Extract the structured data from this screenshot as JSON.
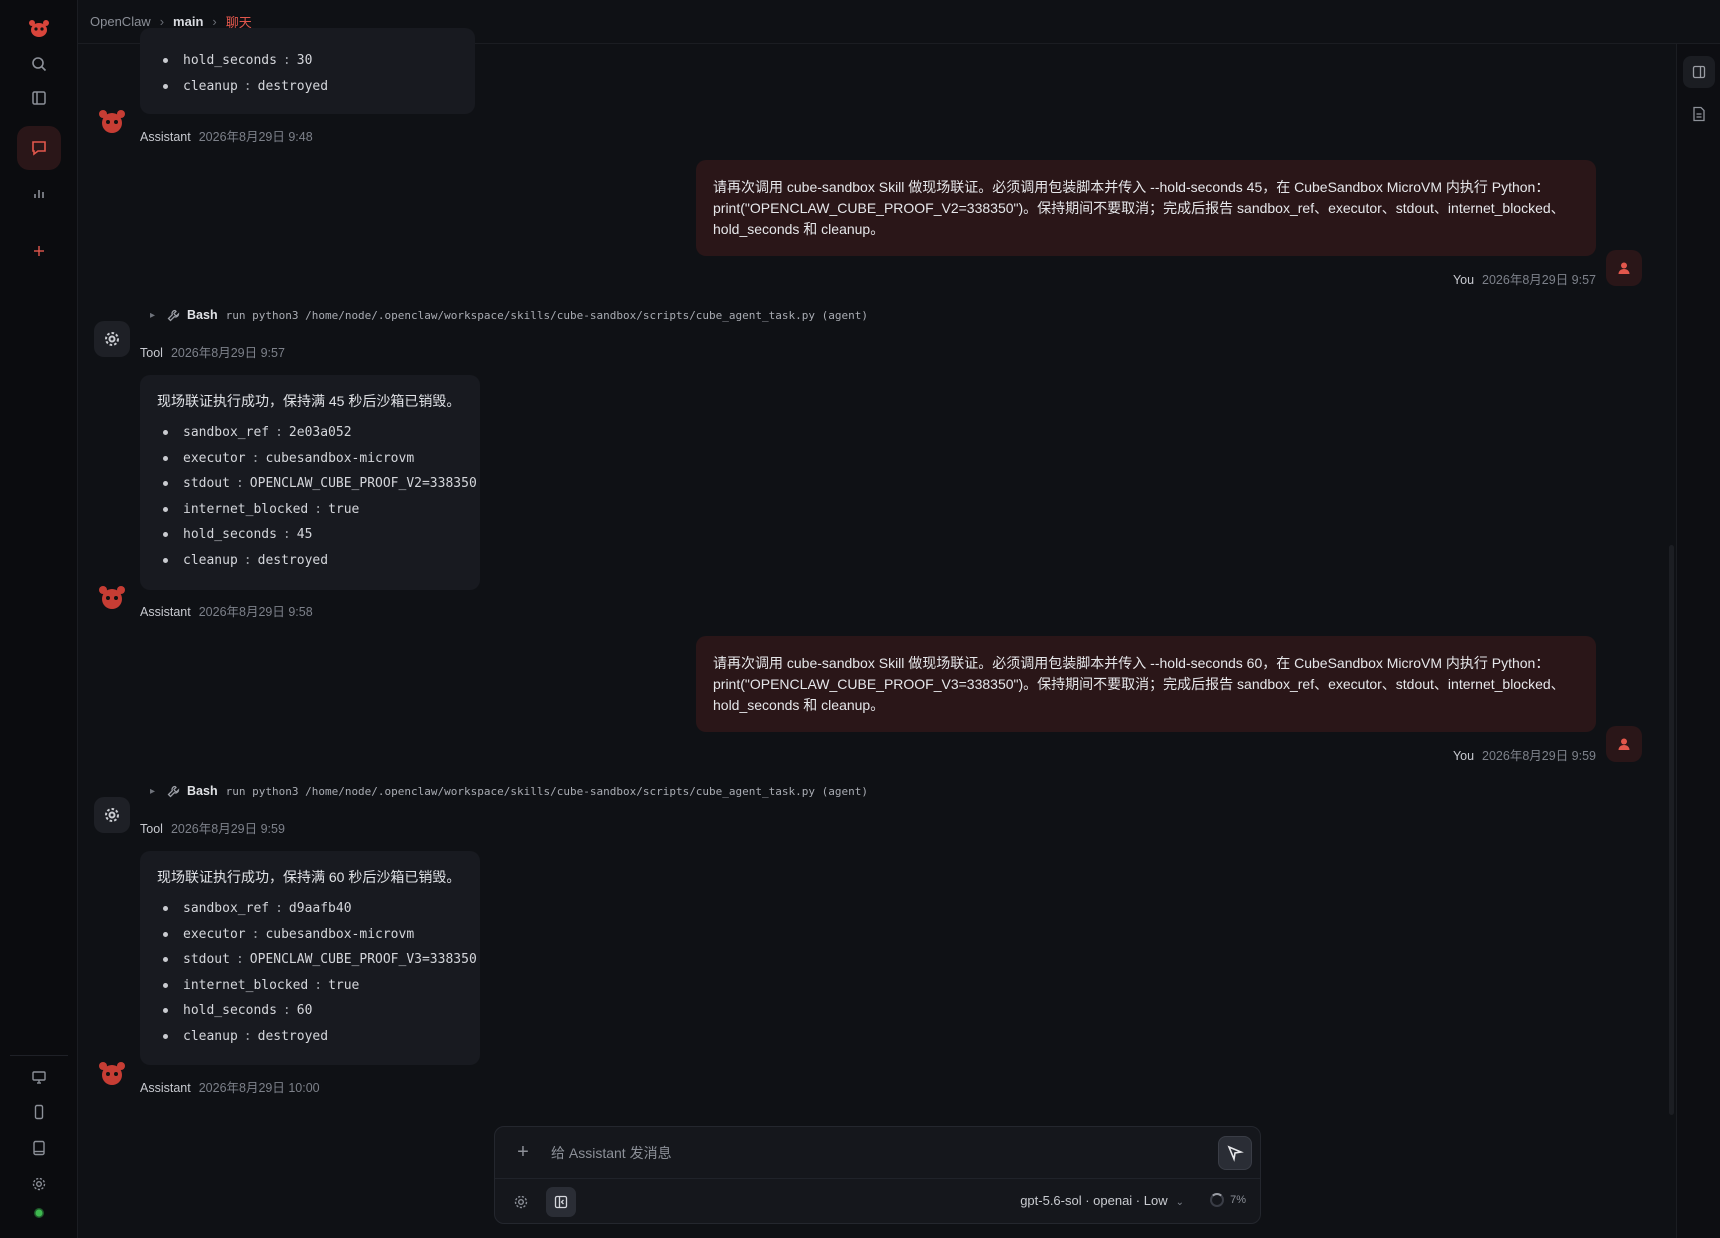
{
  "breadcrumb": {
    "root": "OpenClaw",
    "branch": "main",
    "page": "聊天"
  },
  "colors": {
    "accent": "#e2574c",
    "user_bubble": "#2a1618",
    "assistant_bubble": "#181a20",
    "status_online": "#3fb950"
  },
  "rail": {
    "icons": [
      "logo-icon",
      "search-icon",
      "layout-icon",
      "chat-icon",
      "chart-icon",
      "plus-icon",
      "monitor-icon",
      "phone-icon",
      "tablet-icon",
      "gear-icon",
      "status-dot"
    ]
  },
  "messages": {
    "m0": {
      "items": [
        {
          "k": "hold_seconds",
          "v": "30"
        },
        {
          "k": "cleanup",
          "v": "destroyed"
        }
      ],
      "who": "Assistant",
      "ts": "2026年8月29日 9:48"
    },
    "m1": {
      "text": "请再次调用 cube-sandbox Skill 做现场联证。必须调用包装脚本并传入 --hold-seconds 45，在 CubeSandbox MicroVM 内执行 Python：print(\"OPENCLAW_CUBE_PROOF_V2=338350\")。保持期间不要取消；完成后报告 sandbox_ref、executor、stdout、internet_blocked、hold_seconds 和 cleanup。",
      "who": "You",
      "ts": "2026年8月29日 9:57"
    },
    "m2": {
      "tool": "Bash",
      "cmd": "run python3 /home/node/.openclaw/workspace/skills/cube-sandbox/scripts/cube_agent_task.py (agent)",
      "who": "Tool",
      "ts": "2026年8月29日 9:57"
    },
    "m3": {
      "lead": "现场联证执行成功，保持满 45 秒后沙箱已销毁。",
      "items": [
        {
          "k": "sandbox_ref",
          "v": "2e03a052"
        },
        {
          "k": "executor",
          "v": "cubesandbox-microvm"
        },
        {
          "k": "stdout",
          "v": "OPENCLAW_CUBE_PROOF_V2=338350"
        },
        {
          "k": "internet_blocked",
          "v": "true"
        },
        {
          "k": "hold_seconds",
          "v": "45"
        },
        {
          "k": "cleanup",
          "v": "destroyed"
        }
      ],
      "who": "Assistant",
      "ts": "2026年8月29日 9:58"
    },
    "m4": {
      "text": "请再次调用 cube-sandbox Skill 做现场联证。必须调用包装脚本并传入 --hold-seconds 60，在 CubeSandbox MicroVM 内执行 Python：print(\"OPENCLAW_CUBE_PROOF_V3=338350\")。保持期间不要取消；完成后报告 sandbox_ref、executor、stdout、internet_blocked、hold_seconds 和 cleanup。",
      "who": "You",
      "ts": "2026年8月29日 9:59"
    },
    "m5": {
      "tool": "Bash",
      "cmd": "run python3 /home/node/.openclaw/workspace/skills/cube-sandbox/scripts/cube_agent_task.py (agent)",
      "who": "Tool",
      "ts": "2026年8月29日 9:59"
    },
    "m6": {
      "lead": "现场联证执行成功，保持满 60 秒后沙箱已销毁。",
      "items": [
        {
          "k": "sandbox_ref",
          "v": "d9aafb40"
        },
        {
          "k": "executor",
          "v": "cubesandbox-microvm"
        },
        {
          "k": "stdout",
          "v": "OPENCLAW_CUBE_PROOF_V3=338350"
        },
        {
          "k": "internet_blocked",
          "v": "true"
        },
        {
          "k": "hold_seconds",
          "v": "60"
        },
        {
          "k": "cleanup",
          "v": "destroyed"
        }
      ],
      "who": "Assistant",
      "ts": "2026年8月29日 10:00"
    }
  },
  "composer": {
    "placeholder": "给 Assistant 发消息",
    "model": "gpt-5.6-sol · openai · Low",
    "context": "7%"
  }
}
